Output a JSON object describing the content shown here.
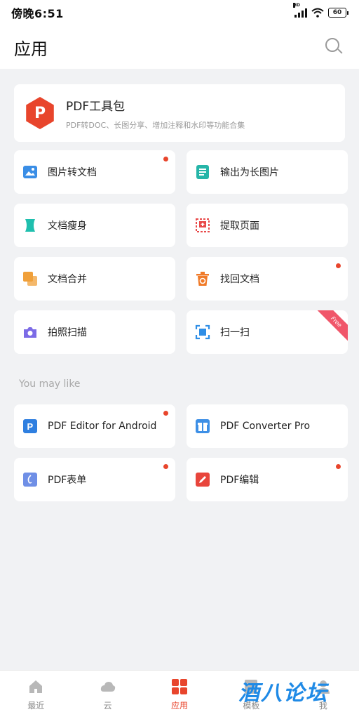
{
  "status_bar": {
    "time": "傍晚6:51",
    "network": "HD",
    "battery": "60"
  },
  "header": {
    "title": "应用",
    "search_icon": "search-icon"
  },
  "feature": {
    "title": "PDF工具包",
    "subtitle": "PDF转DOC、长图分享、增加注释和水印等功能合集",
    "logo_letter": "P",
    "color": "#e8452c"
  },
  "tools": [
    {
      "label": "图片转文档",
      "icon": "image-to-doc-icon",
      "color": "#3a8ee6",
      "new": true
    },
    {
      "label": "输出为长图片",
      "icon": "long-image-icon",
      "color": "#26b5a8",
      "new": false
    },
    {
      "label": "文档瘦身",
      "icon": "slim-doc-icon",
      "color": "#1fbfae",
      "new": false
    },
    {
      "label": "提取页面",
      "icon": "extract-page-icon",
      "color": "#e84a4a",
      "new": false
    },
    {
      "label": "文档合并",
      "icon": "merge-doc-icon",
      "color": "#f0a03a",
      "new": false
    },
    {
      "label": "找回文档",
      "icon": "recover-doc-icon",
      "color": "#f07a28",
      "new": true
    },
    {
      "label": "拍照扫描",
      "icon": "camera-icon",
      "color": "#7c6be6",
      "new": false
    },
    {
      "label": "扫一扫",
      "icon": "scan-icon",
      "color": "#2f8ee6",
      "new": false,
      "ribbon": "Free"
    }
  ],
  "may_like": {
    "label": "You may like",
    "items": [
      {
        "label": "PDF Editor for Android",
        "icon": "pdf-editor-icon",
        "color": "#2f7fe0",
        "new": true
      },
      {
        "label": "PDF Converter Pro",
        "icon": "gift-icon",
        "color": "#3d8fe6",
        "new": false
      },
      {
        "label": "PDF表单",
        "icon": "pdf-form-icon",
        "color": "#6f8fe6",
        "new": true
      },
      {
        "label": "PDF编辑",
        "icon": "pdf-edit-icon",
        "color": "#e8453c",
        "new": true
      }
    ]
  },
  "bottom_nav": [
    {
      "label": "最近",
      "icon": "home-icon",
      "active": false
    },
    {
      "label": "云",
      "icon": "cloud-icon",
      "active": false
    },
    {
      "label": "应用",
      "icon": "apps-icon",
      "active": true
    },
    {
      "label": "模板",
      "icon": "template-icon",
      "active": false
    },
    {
      "label": "我",
      "icon": "profile-icon",
      "active": false
    }
  ],
  "watermark": "酒八论坛"
}
